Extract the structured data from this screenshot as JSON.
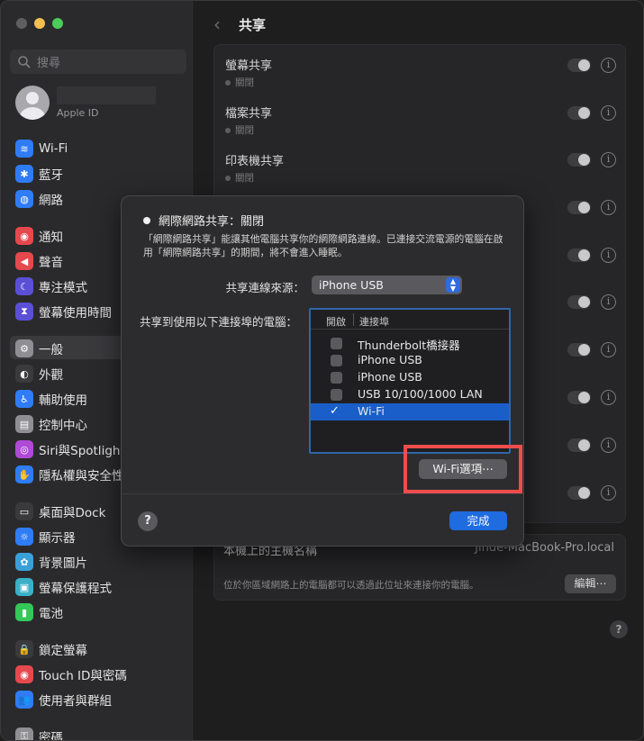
{
  "sidebar": {
    "search_placeholder": "搜尋",
    "account_sub": "Apple ID",
    "items": [
      {
        "label": "Wi-Fi",
        "icon": "wifi-icon",
        "color": "#2f7cf6"
      },
      {
        "label": "藍牙",
        "icon": "bluetooth-icon",
        "color": "#2f7cf6"
      },
      {
        "label": "網路",
        "icon": "globe-icon",
        "color": "#2f7cf6"
      },
      {
        "label": "通知",
        "icon": "bell-icon",
        "color": "#e5484d"
      },
      {
        "label": "聲音",
        "icon": "speaker-icon",
        "color": "#e5484d"
      },
      {
        "label": "專注模式",
        "icon": "moon-icon",
        "color": "#5b4fd6"
      },
      {
        "label": "螢幕使用時間",
        "icon": "hourglass-icon",
        "color": "#5b4fd6"
      },
      {
        "label": "一般",
        "icon": "gear-icon",
        "color": "#8e8e93"
      },
      {
        "label": "外觀",
        "icon": "appearance-icon",
        "color": "#3a3a3c"
      },
      {
        "label": "輔助使用",
        "icon": "accessibility-icon",
        "color": "#2f7cf6"
      },
      {
        "label": "控制中心",
        "icon": "control-center-icon",
        "color": "#8e8e93"
      },
      {
        "label": "Siri與Spotlight",
        "icon": "siri-icon",
        "color": "#b04ad6"
      },
      {
        "label": "隱私權與安全性",
        "icon": "hand-icon",
        "color": "#2f7cf6"
      },
      {
        "label": "桌面與Dock",
        "icon": "dock-icon",
        "color": "#3a3a3c"
      },
      {
        "label": "顯示器",
        "icon": "sun-icon",
        "color": "#2f7cf6"
      },
      {
        "label": "背景圖片",
        "icon": "flower-icon",
        "color": "#3aa0d8"
      },
      {
        "label": "螢幕保護程式",
        "icon": "screensaver-icon",
        "color": "#3ab0c8"
      },
      {
        "label": "電池",
        "icon": "battery-icon",
        "color": "#34c759"
      },
      {
        "label": "鎖定螢幕",
        "icon": "lock-icon",
        "color": "#3a3a3c"
      },
      {
        "label": "Touch ID與密碼",
        "icon": "fingerprint-icon",
        "color": "#e5484d"
      },
      {
        "label": "使用者與群組",
        "icon": "users-icon",
        "color": "#2f7cf6"
      },
      {
        "label": "密碼",
        "icon": "key-icon",
        "color": "#8e8e93"
      }
    ]
  },
  "main": {
    "title": "共享",
    "services": [
      {
        "name": "螢幕共享",
        "state": "關閉"
      },
      {
        "name": "檔案共享",
        "state": "關閉"
      },
      {
        "name": "印表機共享",
        "state": "關閉"
      }
    ],
    "host_label": "本機上的主機名稱",
    "host_value": "Jinde-MacBook-Pro.local",
    "host_desc": "位於你區域網路上的電腦都可以透過此位址來連接你的電腦。",
    "edit_label": "編輯⋯",
    "help_label": "?"
  },
  "sheet": {
    "title": "網際網路共享：關閉",
    "description": "「網際網路共享」能讓其他電腦共享你的網際網路連線。已連接交流電源的電腦在啟用「網際網路共享」的期間，將不會進入睡眠。",
    "source_label": "共享連線來源：",
    "source_value": "iPhone USB",
    "to_label": "共享到使用以下連接埠的電腦：",
    "col_enable": "開啟",
    "col_port": "連接埠",
    "ports": [
      {
        "label": "Thunderbolt橋接器",
        "checked": false
      },
      {
        "label": "iPhone USB",
        "checked": false
      },
      {
        "label": "iPhone USB",
        "checked": false
      },
      {
        "label": "USB 10/100/1000 LAN",
        "checked": false
      },
      {
        "label": "Wi-Fi",
        "checked": true
      }
    ],
    "wifi_options_label": "Wi-Fi選項⋯",
    "help_label": "?",
    "done_label": "完成"
  }
}
